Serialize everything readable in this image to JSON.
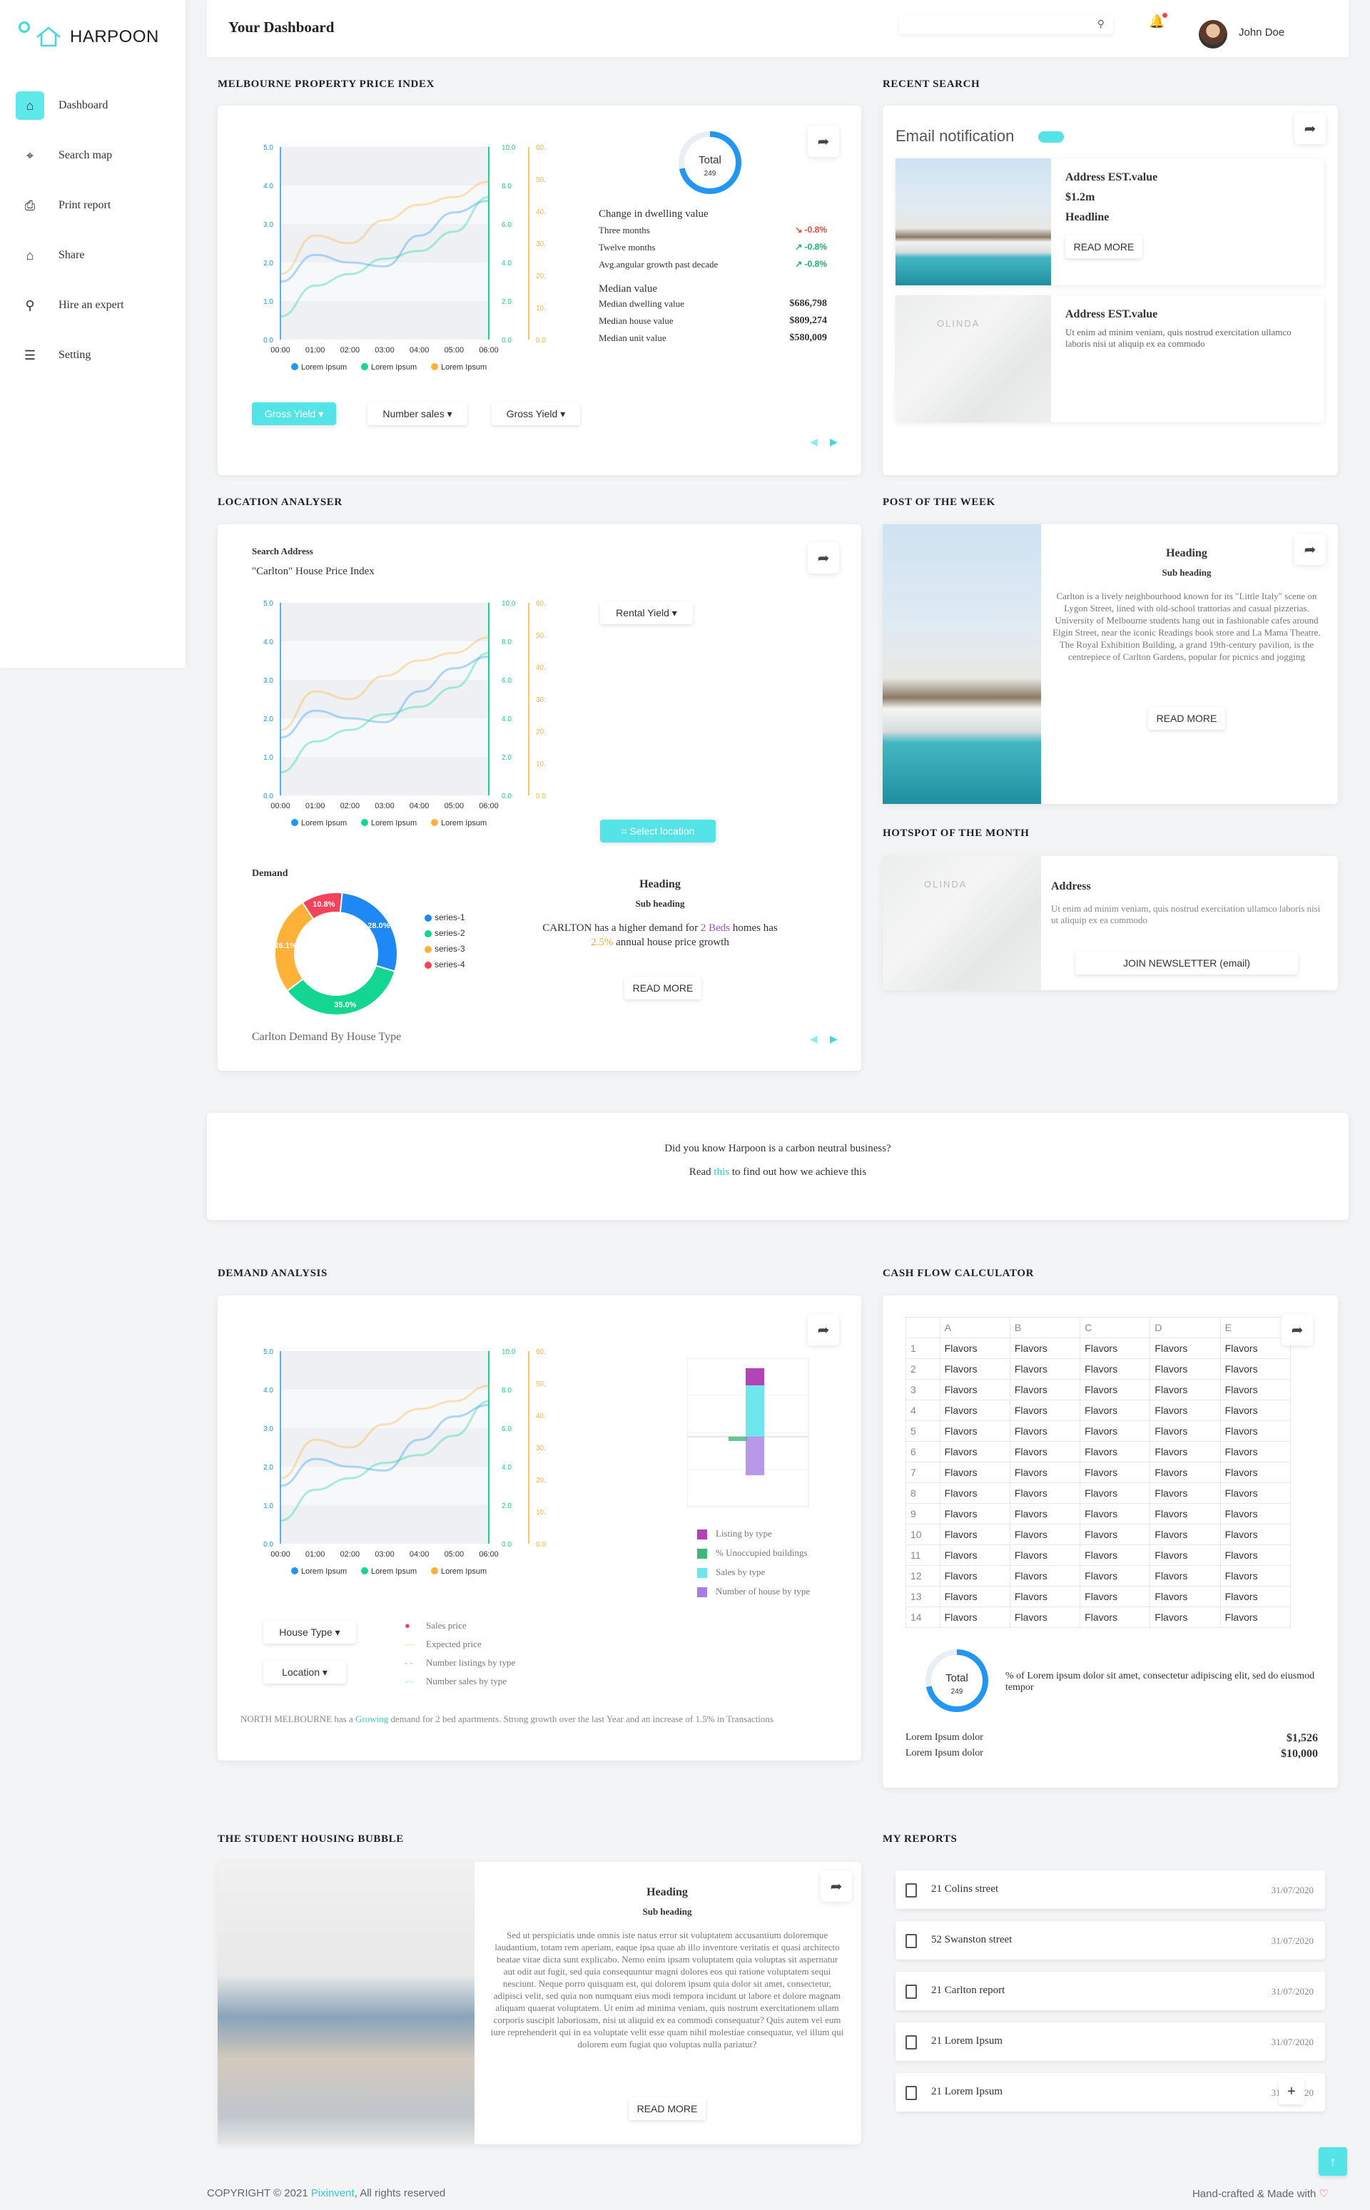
{
  "brand": {
    "name": "HARPOON",
    "accent": "#54e3e6"
  },
  "sidebar": {
    "items": [
      {
        "label": "Dashboard",
        "icon": "home-icon"
      },
      {
        "label": "Search map",
        "icon": "map-pin-icon"
      },
      {
        "label": "Print report",
        "icon": "printer-icon"
      },
      {
        "label": "Share",
        "icon": "home-icon"
      },
      {
        "label": "Hire an expert",
        "icon": "search-icon"
      },
      {
        "label": "Setting",
        "icon": "sliders-icon"
      }
    ]
  },
  "header": {
    "title": "Your Dashboard",
    "user": "John Doe"
  },
  "sections": {
    "mppi": "MELBOURNE PROPERTY PRICE INDEX",
    "recent": "RECENT SEARCH",
    "location": "LOCATION ANALYSER",
    "post": "POST OF THE WEEK",
    "hotspot": "HOTSPOT OF THE MONTH",
    "demand": "DEMAND ANALYSIS",
    "cashflow": "CASH FLOW CALCULATOR",
    "student": "THE STUDENT HOUSING BUBBLE",
    "reports": "MY REPORTS"
  },
  "line_legend": [
    "Lorem Ipsum",
    "Lorem Ipsum",
    "Lorem Ipsum"
  ],
  "mppi": {
    "donut": {
      "label": "Total",
      "value": "249"
    },
    "change_title": "Change in dwelling value",
    "changes": [
      {
        "label": "Three months",
        "value": "↘ -0.8%",
        "color": "#e0493d"
      },
      {
        "label": "Twelve months",
        "value": "↗ -0.8%",
        "color": "#17b36a"
      },
      {
        "label": "Avg.angular growth past decade",
        "value": "↗ -0.8%",
        "color": "#17b36a"
      }
    ],
    "median_title": "Median value",
    "medians": [
      {
        "label": "Median dwelling value",
        "value": "$686,798"
      },
      {
        "label": "Median house value",
        "value": "$809,274"
      },
      {
        "label": "Median unit value",
        "value": "$580,009"
      }
    ],
    "buttons": [
      "Gross Yield",
      "Number sales",
      "Gross Yield"
    ]
  },
  "recent": {
    "notification": "Email notification",
    "card1": {
      "address": "Address EST.value",
      "price": "$1.2m",
      "headline": "Headline",
      "button": "READ MORE"
    },
    "card2": {
      "address": "Address EST.value",
      "text": "Ut enim ad minim veniam, quis nostrud exercitation ullamco laboris nisi ut aliquip ex ea commodo",
      "map": "OLINDA"
    }
  },
  "location": {
    "search_label": "Search Address",
    "subtitle": "\"Carlton\" House Price Index",
    "rental": "Rental Yield",
    "select": "Select location",
    "demand_label": "Demand",
    "heading": "Heading",
    "subheading": "Sub heading",
    "text_a": "CARLTON has a higher demand for ",
    "text_b": "2 Beds",
    "text_c": " homes has",
    "text_d": "2.5%",
    "text_e": " annual house price growth",
    "button": "READ MORE",
    "caption": "Carlton Demand By House Type",
    "pie_legend": [
      "series-1",
      "series-2",
      "series-3",
      "series-4"
    ]
  },
  "post": {
    "heading": "Heading",
    "subheading": "Sub heading",
    "text": "Carlton is a lively neighbourhood known for its \"Little Italy\" scene on Lygon Street, lined with old-school trattorias and casual pizzerias. University of Melbourne students hang out in fashionable cafes around Elgin Street, near the iconic Readings book store and La Mama Theatre. The Royal Exhibition Building, a grand 19th-century pavilion, is the centrepiece of Carlton Gardens, popular for picnics and jogging",
    "button": "READ MORE"
  },
  "hotspot": {
    "map": "OLINDA",
    "title": "Address",
    "text": "Ut enim ad minim veniam, quis nostrud exercitation ullamco laboris nisi ut aliquip ex ea commodo",
    "button": "JOIN NEWSLETTER (email)"
  },
  "banner": {
    "line1": "Did you know Harpoon is a carbon neutral business?",
    "read": "Read ",
    "link": "this",
    "rest": " to find out how we achieve this"
  },
  "demand": {
    "bar_legend": [
      "Listing by type",
      "% Unoccupied buildings",
      "Sales by type",
      "Number of house by type"
    ],
    "line_types": [
      "Sales price",
      "Expected price",
      "Number listings by type",
      "Number sales by type"
    ],
    "house_type": "House Type",
    "location": "Location",
    "note_a": "NORTH MELBOURNE has a ",
    "note_b": "Growing",
    "note_c": " demand for 2 bed apartments. Strong growth over the last Year and an increase of 1.5% in Transactions"
  },
  "cashflow": {
    "columns": [
      "",
      "A",
      "B",
      "C",
      "D",
      "E"
    ],
    "rows": [
      "1",
      "2",
      "3",
      "4",
      "5",
      "6",
      "7",
      "8",
      "9",
      "10",
      "11",
      "12",
      "13",
      "14"
    ],
    "cell": "Flavors",
    "donut": {
      "label": "Total",
      "value": "249"
    },
    "donut_text": "% of Lorem ipsum dolor sit amet, consectetur adipiscing elit, sed do eiusmod tempor",
    "lines": [
      {
        "label": "Lorem Ipsum dolor",
        "value": "$1,526"
      },
      {
        "label": "Lorem Ipsum dolor",
        "value": "$10,000"
      }
    ]
  },
  "student": {
    "heading": "Heading",
    "subheading": "Sub heading",
    "text": "Sed ut perspiciatis unde omnis iste natus error sit voluptatem accusantium doloremque laudantium, totam rem aperiam, eaque ipsa quae ab illo inventore veritatis et quasi architecto beatae vitae dicta sunt explicabo. Nemo enim ipsam voluptatem quia voluptas sit aspernatur aut odit aut fugit, sed quia consequuntur magni dolores eos qui ratione voluptatem sequi nesciunt. Neque porro quisquam est, qui dolorem ipsum quia dolor sit amet, consectetur, adipisci velit, sed quia non numquam eius modi tempora incidunt ut labore et dolore magnam aliquam quaerat voluptatem. Ut enim ad minima veniam, quis nostrum exercitationem ullam corporis suscipit laboriosam, nisi ut aliquid ex ea commodi consequatur? Quis autem vel eum iure reprehenderit qui in ea voluptate velit esse quam nihil molestiae consequatur, vel illum qui dolorem eum fugiat quo voluptas nulla pariatur?",
    "button": "READ MORE"
  },
  "reports": [
    {
      "name": "21 Colins street",
      "date": "31/07/2020"
    },
    {
      "name": "52 Swanston street",
      "date": "31/07/2020"
    },
    {
      "name": "21 Carlton report",
      "date": "31/07/2020"
    },
    {
      "name": "21 Lorem Ipsum",
      "date": "31/07/2020"
    },
    {
      "name": "21 Lorem Ipsum",
      "date": "31/07/2020"
    }
  ],
  "footer": {
    "copy": "COPYRIGHT © 2021 ",
    "brand": "Pixinvent",
    "rest": ", All rights reserved",
    "right": "Hand-crafted & Made with"
  },
  "chart_data": [
    {
      "type": "line",
      "x": [
        "00:00",
        "01:00",
        "02:00",
        "03:00",
        "04:00",
        "05:00",
        "06:00"
      ],
      "yticks_left": [
        "0.0",
        "1.0",
        "2.0",
        "3.0",
        "4.0",
        "5.0"
      ],
      "yticks_mid": [
        "0.0",
        "2.0",
        "4.0",
        "6.0",
        "8.0",
        "10.0"
      ],
      "yticks_right": [
        "0.0",
        "10.0",
        "20.0",
        "30.0",
        "40.0",
        "50.0",
        "60.0"
      ],
      "series": [
        {
          "name": "Lorem Ipsum",
          "color": "#2196f3",
          "values": [
            1.5,
            2.2,
            2.0,
            1.9,
            2.7,
            3.3,
            3.6
          ]
        },
        {
          "name": "Lorem Ipsum",
          "color": "#13d690",
          "values": [
            0.6,
            1.4,
            1.7,
            2.1,
            2.3,
            2.8,
            3.7
          ]
        },
        {
          "name": "Lorem Ipsum",
          "color": "#ffb237",
          "values": [
            1.7,
            2.7,
            2.5,
            3.1,
            3.5,
            3.7,
            4.1
          ]
        }
      ]
    },
    {
      "type": "pie",
      "values": [
        28.0,
        35.0,
        26.1,
        10.8
      ],
      "labels": [
        "28.0%",
        "35.0%",
        "26.1%",
        "10.8%"
      ],
      "series": [
        "series-1",
        "series-2",
        "series-3",
        "series-4"
      ],
      "colors": [
        "#1e88f5",
        "#13d690",
        "#ffb237",
        "#f2435a"
      ]
    },
    {
      "type": "bar",
      "series": [
        {
          "name": "Sales by type",
          "color": "#6fe6ec",
          "values": [
            1.2
          ]
        },
        {
          "name": "Listing by type",
          "color": "#b244b8",
          "values": [
            0.4
          ]
        },
        {
          "name": "% Unoccupied buildings",
          "color": "#3cb878",
          "values": [
            -0.1
          ]
        },
        {
          "name": "Number of house by type",
          "color": "#a77ee3",
          "values": [
            -0.9
          ]
        }
      ]
    }
  ]
}
